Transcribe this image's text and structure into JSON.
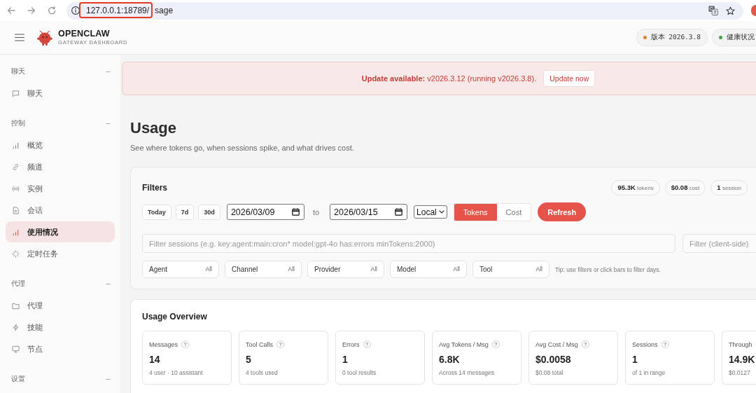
{
  "browser": {
    "url_host": "127.0.0.1:18789/",
    "url_path": "sage",
    "annotated": true
  },
  "header": {
    "brand": "OPENCLAW",
    "tagline": "GATEWAY DASHBOARD",
    "badges": [
      {
        "label": "版本 2026.3.8",
        "color": "#d9822b"
      },
      {
        "label": "健康状况",
        "color": "#43a047"
      }
    ]
  },
  "sidebar": {
    "groups": [
      {
        "title": "聊天",
        "expanded": true,
        "items": [
          {
            "label": "聊天",
            "selected": false
          }
        ]
      },
      {
        "title": "控制",
        "expanded": true,
        "items": [
          {
            "label": "概览",
            "selected": false
          },
          {
            "label": "频道",
            "selected": false
          },
          {
            "label": "实例",
            "selected": false
          },
          {
            "label": "会话",
            "selected": false
          },
          {
            "label": "使用情况",
            "selected": true
          },
          {
            "label": "定时任务",
            "selected": false
          }
        ]
      },
      {
        "title": "代理",
        "expanded": true,
        "items": [
          {
            "label": "代理",
            "selected": false
          },
          {
            "label": "技能",
            "selected": false
          },
          {
            "label": "节点",
            "selected": false
          }
        ]
      },
      {
        "title": "设置",
        "expanded": true
      }
    ]
  },
  "banner": {
    "message": "**Update available:** v2026.3.12 (running v2026.3.8).",
    "button": "Update now"
  },
  "page": {
    "title": "Usage",
    "subtitle": "See where tokens go, when sessions spike, and what drives cost."
  },
  "filters": {
    "title": "Filters",
    "summary": [
      {
        "value": "95.3K",
        "unit": "tokens"
      },
      {
        "value": "$0.08",
        "unit": "cost"
      },
      {
        "value": "1",
        "unit": "session"
      }
    ],
    "ranges": [
      "Today",
      "7d",
      "30d"
    ],
    "from": "2026/03/09",
    "to_label": "to",
    "to": "2026/03/15",
    "timezone": "Local",
    "metric_toggle": [
      {
        "label": "Tokens",
        "selected": true
      },
      {
        "label": "Cost",
        "selected": false
      }
    ],
    "refresh": "Refresh",
    "query": {
      "placeholder": "Filter sessions (e.g. key:agent:main:cron* model:gpt-4o has:errors minTokens:2000)"
    },
    "client_filter": {
      "placeholder": "Filter (client-side)"
    },
    "dropdowns": [
      {
        "label": "Agent",
        "value": "All"
      },
      {
        "label": "Channel",
        "value": "All"
      },
      {
        "label": "Provider",
        "value": "All"
      },
      {
        "label": "Model",
        "value": "All"
      },
      {
        "label": "Tool",
        "value": "All"
      }
    ],
    "tip": "Tip: use filters or click bars to filter days."
  },
  "overview": {
    "title": "Usage Overview",
    "stats": [
      {
        "label": "Messages",
        "help": "?",
        "value": "14",
        "detail": "4 user · 10 assistant"
      },
      {
        "label": "Tool Calls",
        "help": "?",
        "value": "5",
        "detail": "4 tools used"
      },
      {
        "label": "Errors",
        "help": "?",
        "value": "1",
        "detail": "0 tool results"
      },
      {
        "label": "Avg Tokens / Msg",
        "help": "?",
        "value": "6.8K",
        "detail": "Across 14 messages"
      },
      {
        "label": "Avg Cost / Msg",
        "help": "?",
        "value": "$0.0058",
        "detail": "$0.08 total"
      },
      {
        "label": "Sessions",
        "help": "?",
        "value": "1",
        "detail": "of 1 in range"
      },
      {
        "label": "Through",
        "value": "14.9K",
        "detail": "$0.0127"
      }
    ]
  }
}
